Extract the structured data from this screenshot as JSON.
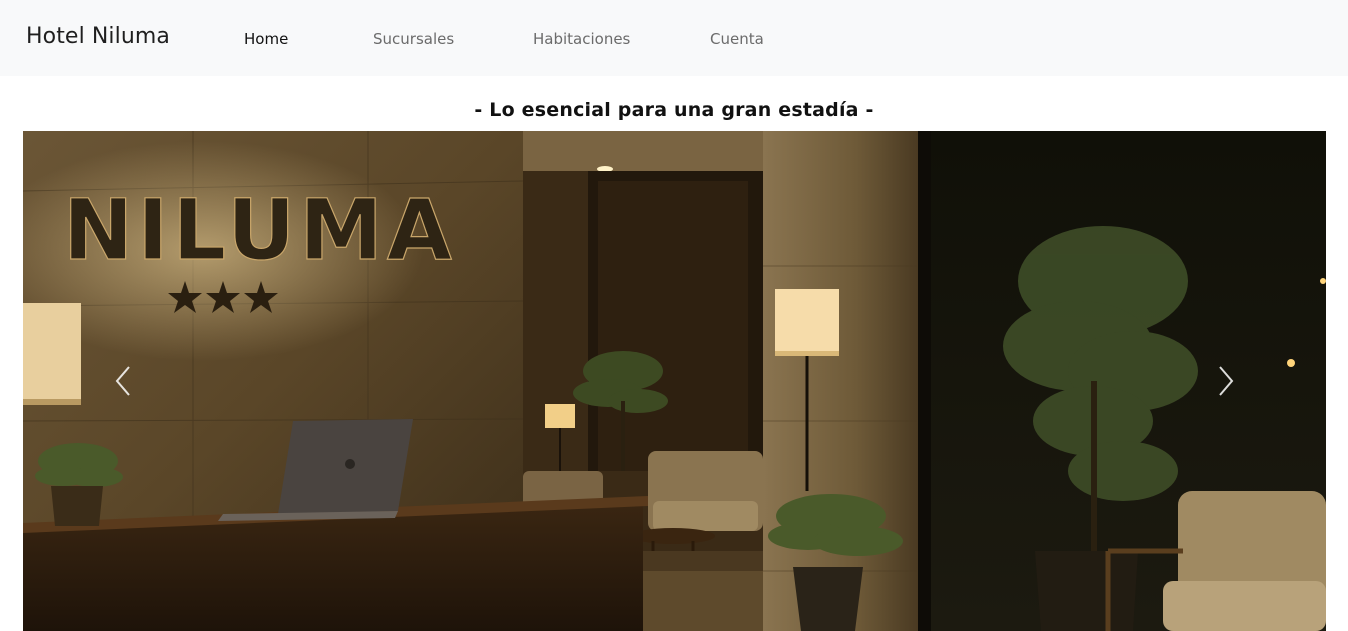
{
  "navbar": {
    "brand": "Hotel Niluma",
    "links": [
      {
        "label": "Home",
        "active": true
      },
      {
        "label": "Sucursales",
        "active": false
      },
      {
        "label": "Habitaciones",
        "active": false
      },
      {
        "label": "Cuenta",
        "active": false
      }
    ]
  },
  "tagline": "- Lo esencial para una gran estadía -",
  "carousel": {
    "slide_sign": "NILUMA",
    "prev_icon": "chevron-left-icon",
    "next_icon": "chevron-right-icon"
  },
  "colors": {
    "navbar_bg": "#f8f9fa",
    "text_dark": "#111111",
    "nav_muted": "#6b6b6b"
  }
}
